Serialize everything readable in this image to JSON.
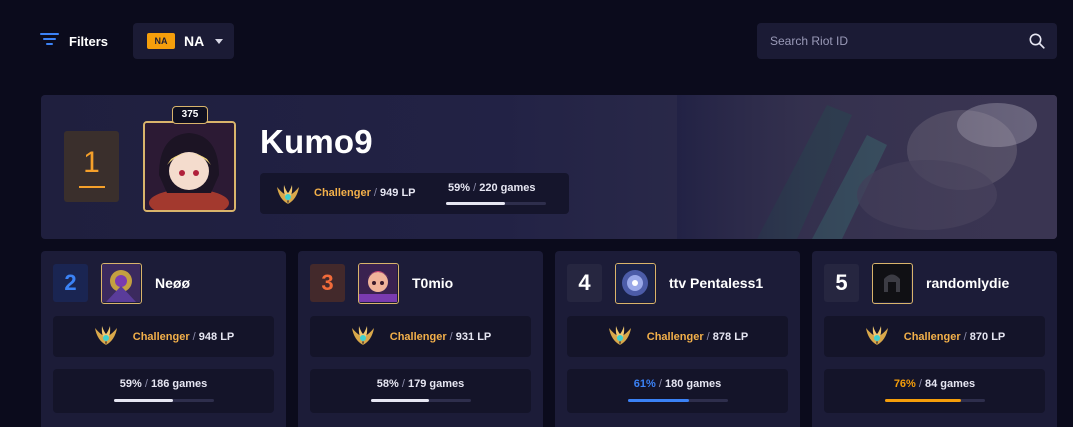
{
  "toolbar": {
    "filters_label": "Filters",
    "region_badge": "NA",
    "region_name": "NA",
    "search_placeholder": "Search Riot ID"
  },
  "colors": {
    "accent_gold": "#f3b04a",
    "accent_blue": "#3b82f6",
    "accent_orange": "#f59e0b",
    "rank1": "#f5a02a",
    "rank2": "#3b82f6",
    "rank3": "#f26b3a"
  },
  "leader": {
    "rank": "1",
    "level": "375",
    "name": "Kumo9",
    "tier": "Challenger",
    "lp": "949 LP",
    "winrate": "59%",
    "games": "220 games",
    "winrate_value": 59
  },
  "players": [
    {
      "rank": "2",
      "name": "Neøø",
      "tier": "Challenger",
      "lp": "948 LP",
      "winrate": "59%",
      "games": "186 games",
      "winrate_value": 59
    },
    {
      "rank": "3",
      "name": "T0mio",
      "tier": "Challenger",
      "lp": "931 LP",
      "winrate": "58%",
      "games": "179 games",
      "winrate_value": 58
    },
    {
      "rank": "4",
      "name": "ttv Pentaless1",
      "tier": "Challenger",
      "lp": "878 LP",
      "winrate": "61%",
      "games": "180 games",
      "winrate_value": 61
    },
    {
      "rank": "5",
      "name": "randomlydie",
      "tier": "Challenger",
      "lp": "870 LP",
      "winrate": "76%",
      "games": "84 games",
      "winrate_value": 76
    }
  ],
  "separator": " / ",
  "icons": {
    "filters": "filter-lines-icon",
    "region_caret": "caret-down-icon",
    "search": "search-icon",
    "tier_emblem": "challenger-emblem-icon"
  }
}
